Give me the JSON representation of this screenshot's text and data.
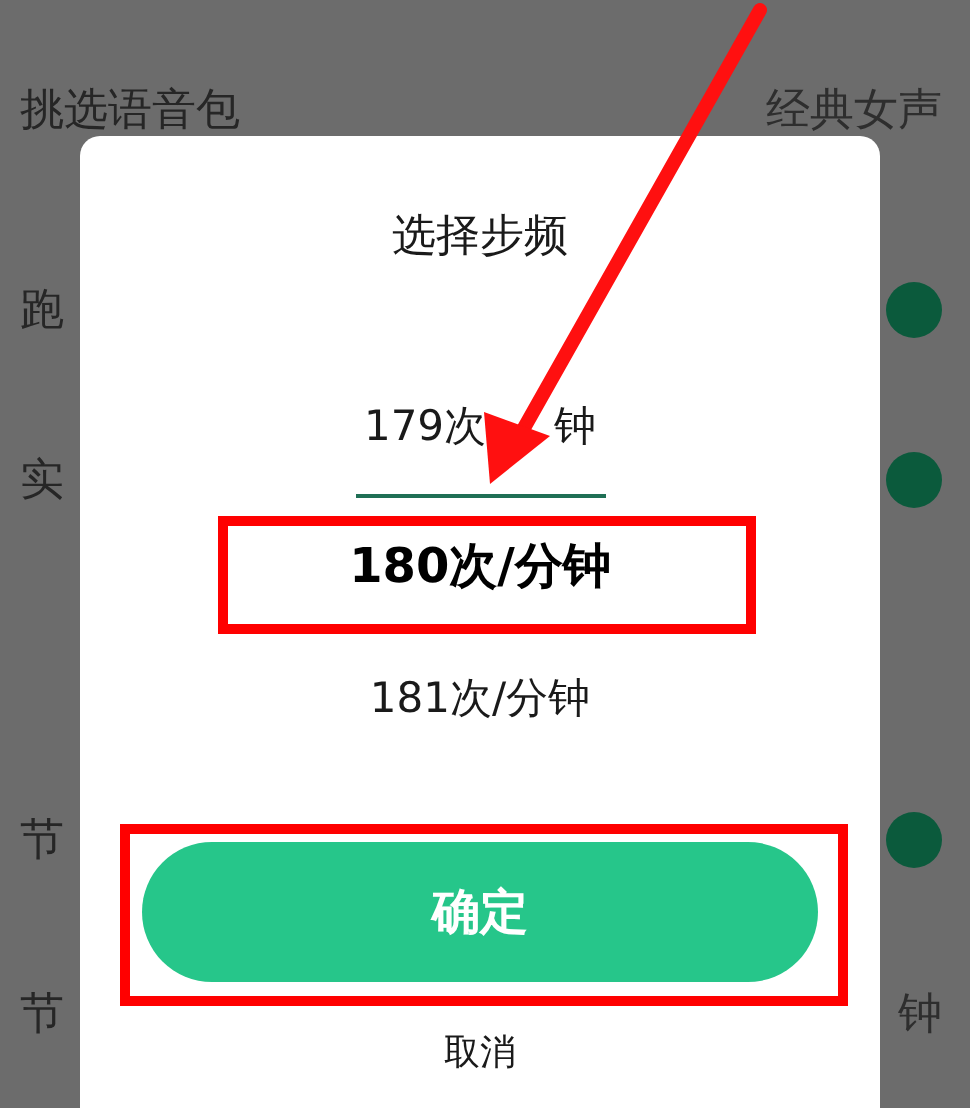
{
  "settings": [
    {
      "label": "挑选语音包",
      "kind": "value",
      "value": "经典女声"
    },
    {
      "label": "跑",
      "kind": "toggle",
      "on": true
    },
    {
      "label": "实",
      "kind": "toggle",
      "on": true
    },
    {
      "label": "节",
      "kind": "toggle",
      "on": true
    },
    {
      "label": "节",
      "kind": "value",
      "value": "钟"
    }
  ],
  "dialog": {
    "title": "选择步频",
    "options": [
      {
        "label": "179次",
        "label_tail": "钟",
        "selected": false
      },
      {
        "label": "180次/分钟",
        "selected": true
      },
      {
        "label": "181次/分钟",
        "selected": false
      }
    ],
    "confirm_button": "确定",
    "cancel_button": "取消"
  }
}
